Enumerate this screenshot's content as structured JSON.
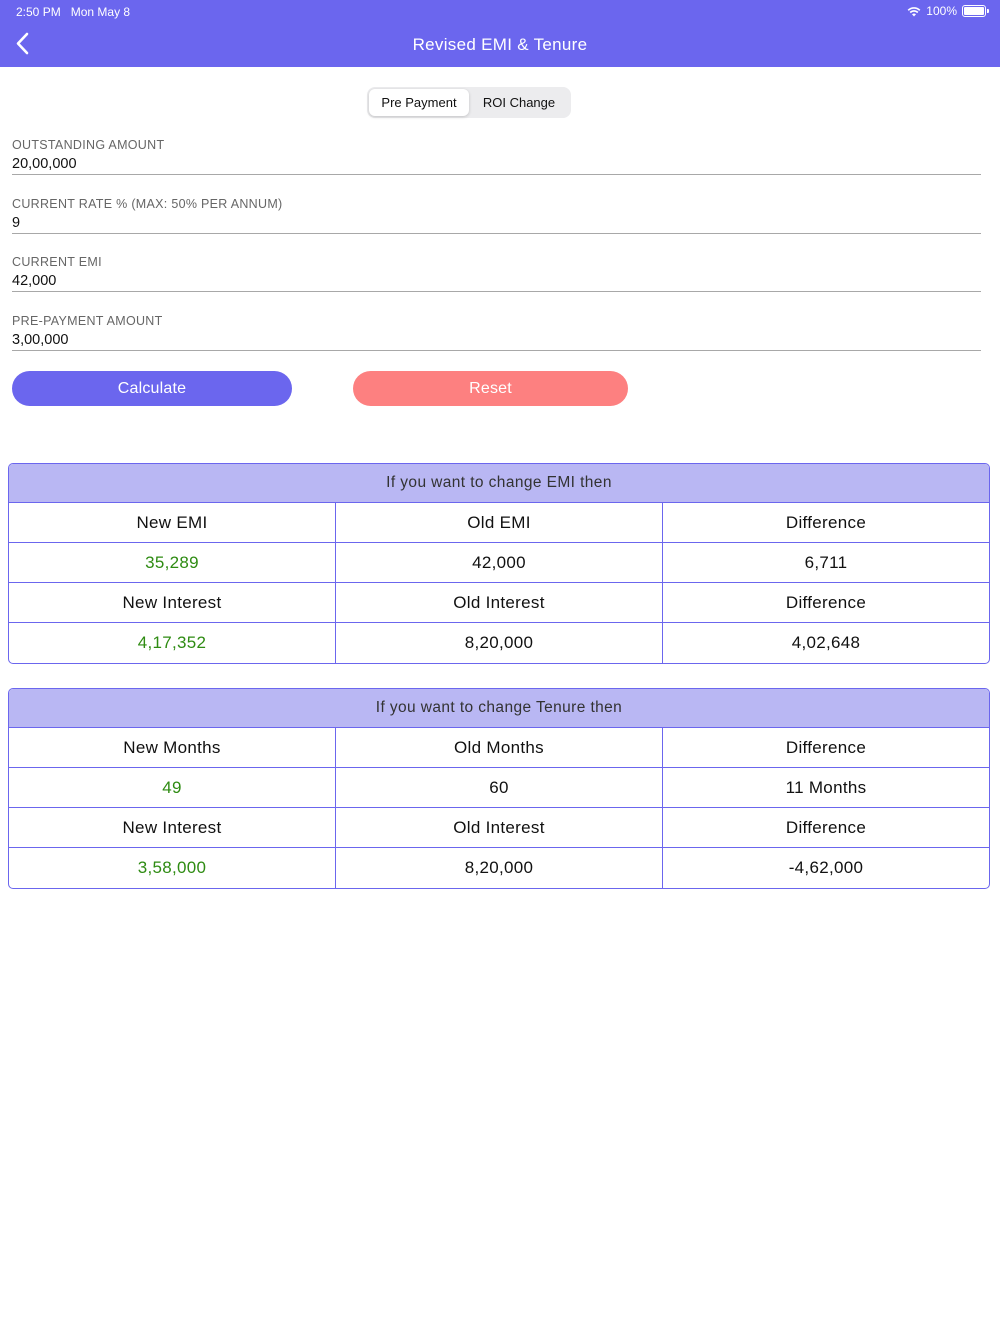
{
  "status_bar": {
    "time": "2:50 PM",
    "date": "Mon May 8",
    "wifi_icon": "wifi-icon",
    "battery": "100%"
  },
  "nav": {
    "back_icon": "chevron-left-icon",
    "title": "Revised EMI & Tenure"
  },
  "segments": {
    "selected": "Pre Payment",
    "items": [
      "Pre Payment",
      "ROI Change"
    ]
  },
  "form": {
    "outstanding": {
      "label": "OUTSTANDING AMOUNT",
      "value": "20,00,000"
    },
    "rate": {
      "label": "CURRENT RATE % (MAX: 50% PER ANNUM)",
      "value": "9"
    },
    "emi": {
      "label": "CURRENT EMI",
      "value": "42,000"
    },
    "prepayment": {
      "label": "PRE-PAYMENT AMOUNT",
      "value": "3,00,000"
    }
  },
  "buttons": {
    "calculate": "Calculate",
    "reset": "Reset"
  },
  "emi_card": {
    "title": "If you want to change EMI then",
    "rows": [
      [
        "New EMI",
        "Old EMI",
        "Difference"
      ],
      [
        "35,289",
        "42,000",
        "6,711"
      ],
      [
        "New Interest",
        "Old Interest",
        "Difference"
      ],
      [
        "4,17,352",
        "8,20,000",
        "4,02,648"
      ]
    ]
  },
  "tenure_card": {
    "title": "If you want to change Tenure then",
    "rows": [
      [
        "New Months",
        "Old Months",
        "Difference"
      ],
      [
        "49",
        "60",
        "11 Months"
      ],
      [
        "New Interest",
        "Old Interest",
        "Difference"
      ],
      [
        "3,58,000",
        "8,20,000",
        "-4,62,000"
      ]
    ]
  },
  "colors": {
    "accent": "#6b66ee",
    "reset": "#fd8080",
    "card_header": "#b9b7f3",
    "positive_value": "#2e8b12"
  }
}
